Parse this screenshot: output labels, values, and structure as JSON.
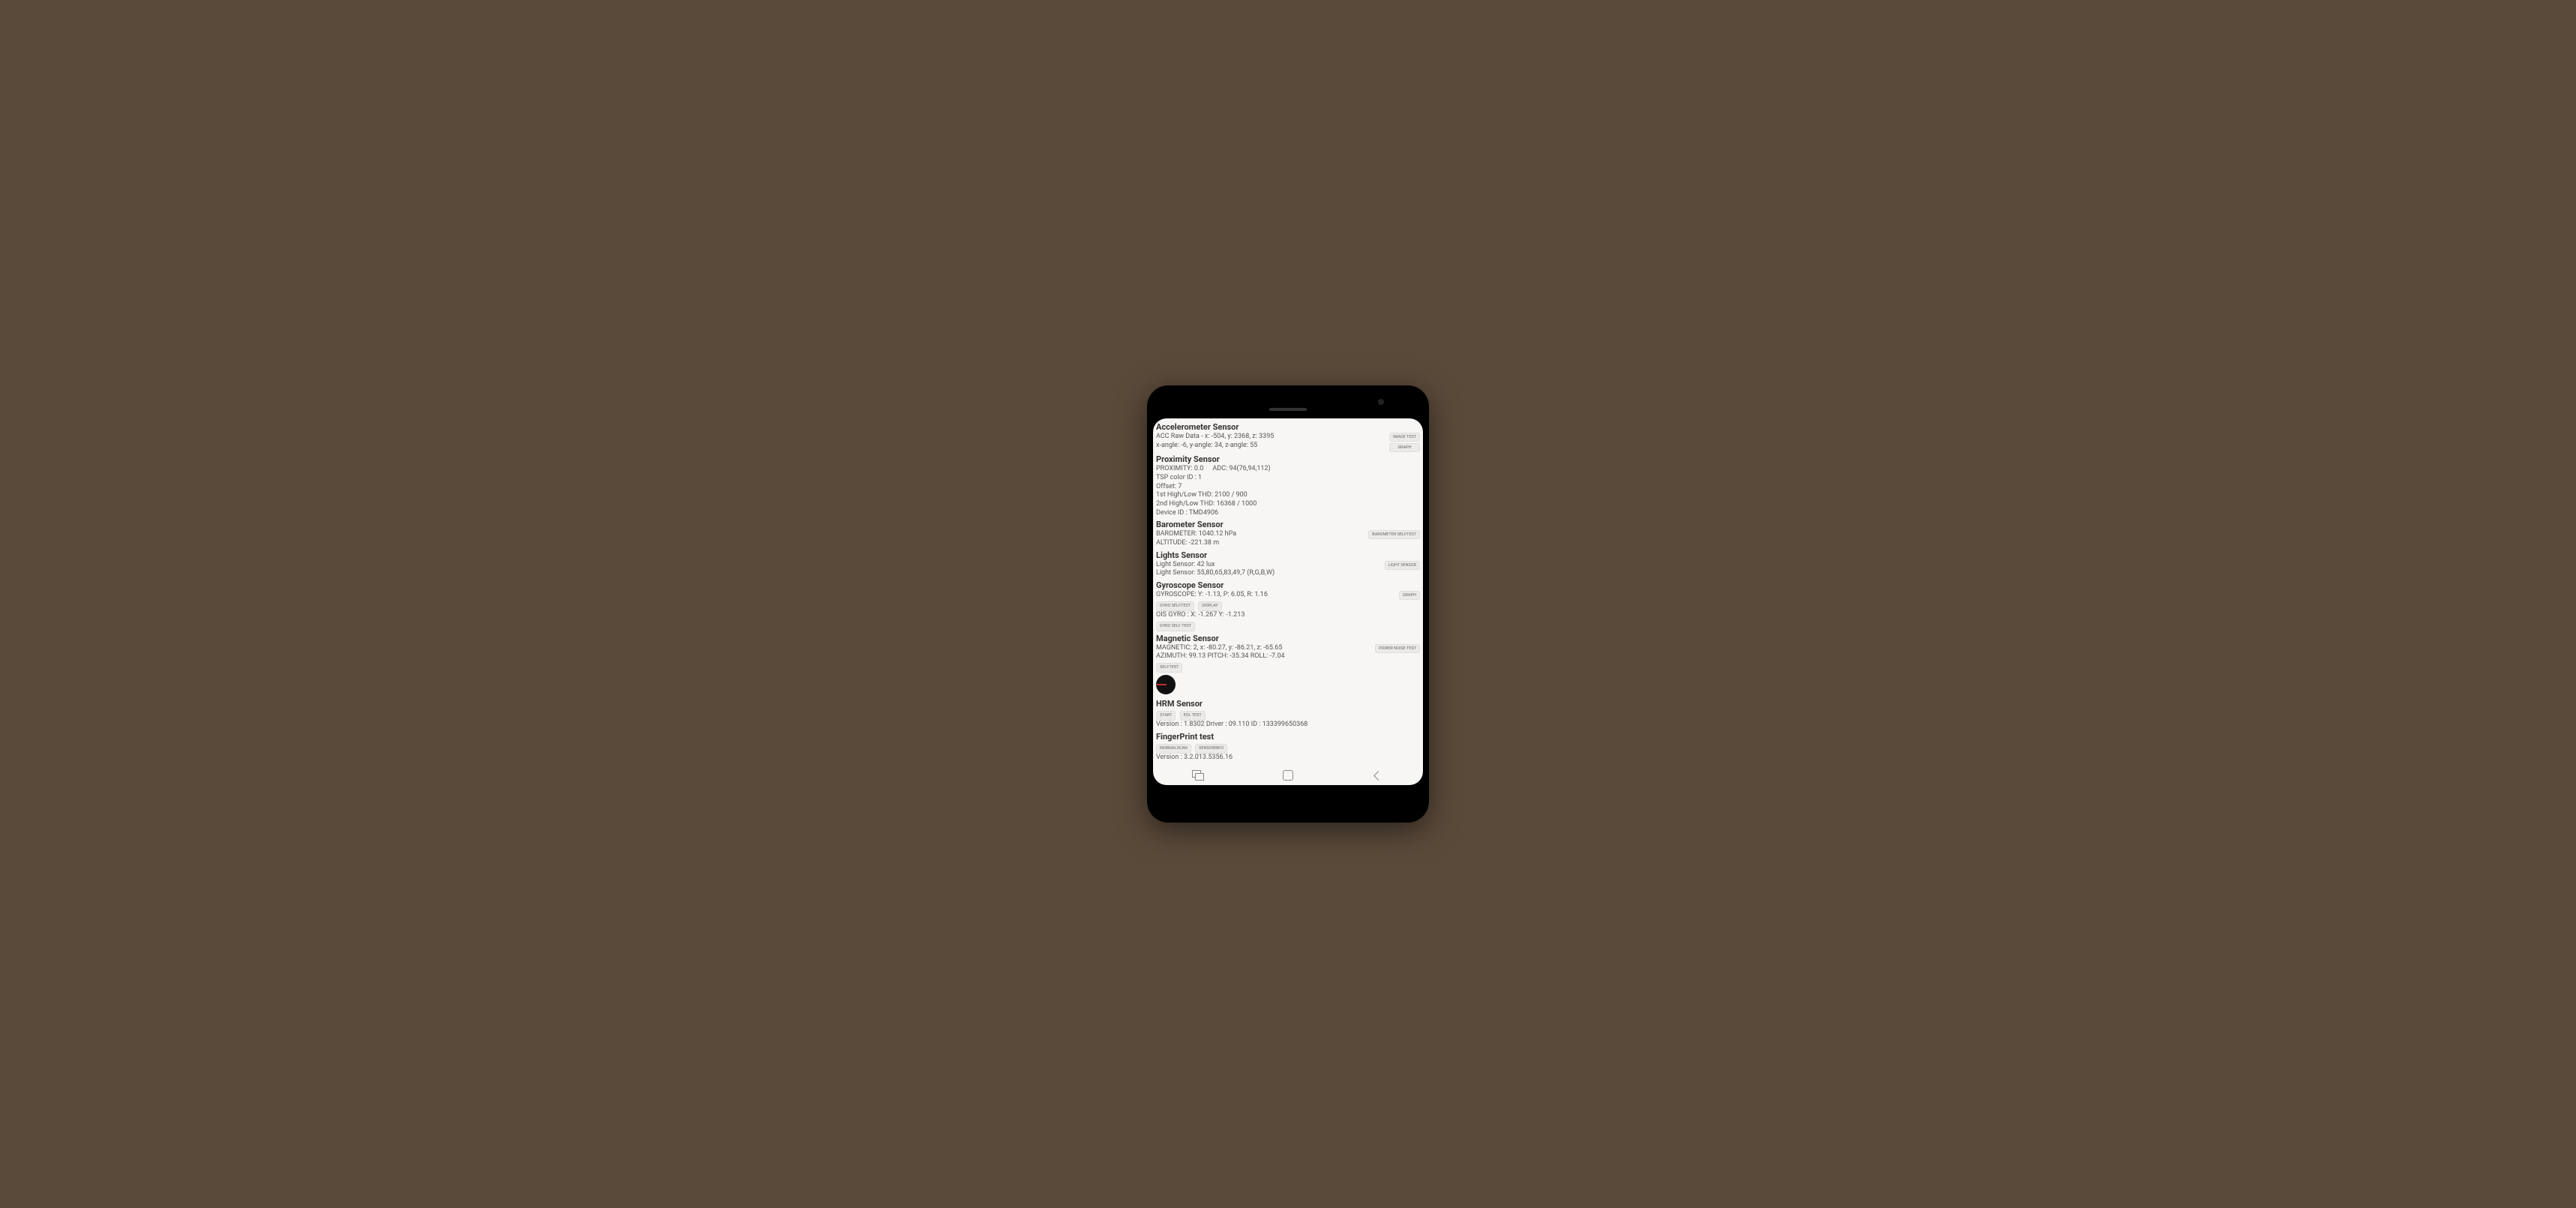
{
  "sections": {
    "accel": {
      "title": "Accelerometer Sensor",
      "raw": "ACC Raw Data - x: -504, y: 2368, z: 3395",
      "angles": "x-angle: -6, y-angle: 34, z-angle: 55",
      "btn_image": "IMAGE TEST",
      "btn_graph": "GRAPH"
    },
    "prox": {
      "title": "Proximity Sensor",
      "line1": "PROXIMITY: 0.0",
      "adc": "ADC: 94(76,94,112)",
      "line2": "TSP color ID : 1",
      "line3": "Offset: 7",
      "line4": "1st High/Low THD: 2100 / 900",
      "line5": "2nd High/Low THD: 16368 / 1000",
      "line6": "Device ID : TMD4906"
    },
    "baro": {
      "title": "Barometer Sensor",
      "line1": "BAROMETER: 1040.12 hPa",
      "line2": "ALTITUDE: -221.38 m",
      "btn": "BAROMETER SELFTEST"
    },
    "light": {
      "title": "Lights Sensor",
      "line1": "Light Sensor: 42 lux",
      "line2": "Light Sensor: 55,80,65,83,49,7 (R,G,B,W)",
      "btn": "LIGHT SENSOR"
    },
    "gyro": {
      "title": "Gyroscope Sensor",
      "line1": "GYROSCOPE: Y: -1.13, P: 6.05, R: 1.16",
      "btn_self": "GYRO SELFTEST",
      "btn_display": "DISPLAY",
      "btn_graph": "GRAPH",
      "line2": "OIS GYRO : X: -1.267 Y: -1.213",
      "btn_self2": "GYRO SELF TEST"
    },
    "mag": {
      "title": "Magnetic Sensor",
      "line1": "MAGNETIC: 2, x: -80.27, y: -86.21, z: -65.65",
      "line2": "AZIMUTH: 99.13   PITCH: -35.34   ROLL: -7.04",
      "btn_self": "SELFTEST",
      "btn_power": "POWER NOISE TEST"
    },
    "hrm": {
      "title": "HRM Sensor",
      "btn_start": "START",
      "btn_eol": "EOL TEST",
      "line1": "Version : 1.8302   Driver : 09.110   ID : 133399650368"
    },
    "fp": {
      "title": "FingerPrint test",
      "btn_scan": "NORMALSCAN",
      "btn_info": "SENSORINFO",
      "line1": "Version : 3.2.013.5356.16"
    }
  }
}
